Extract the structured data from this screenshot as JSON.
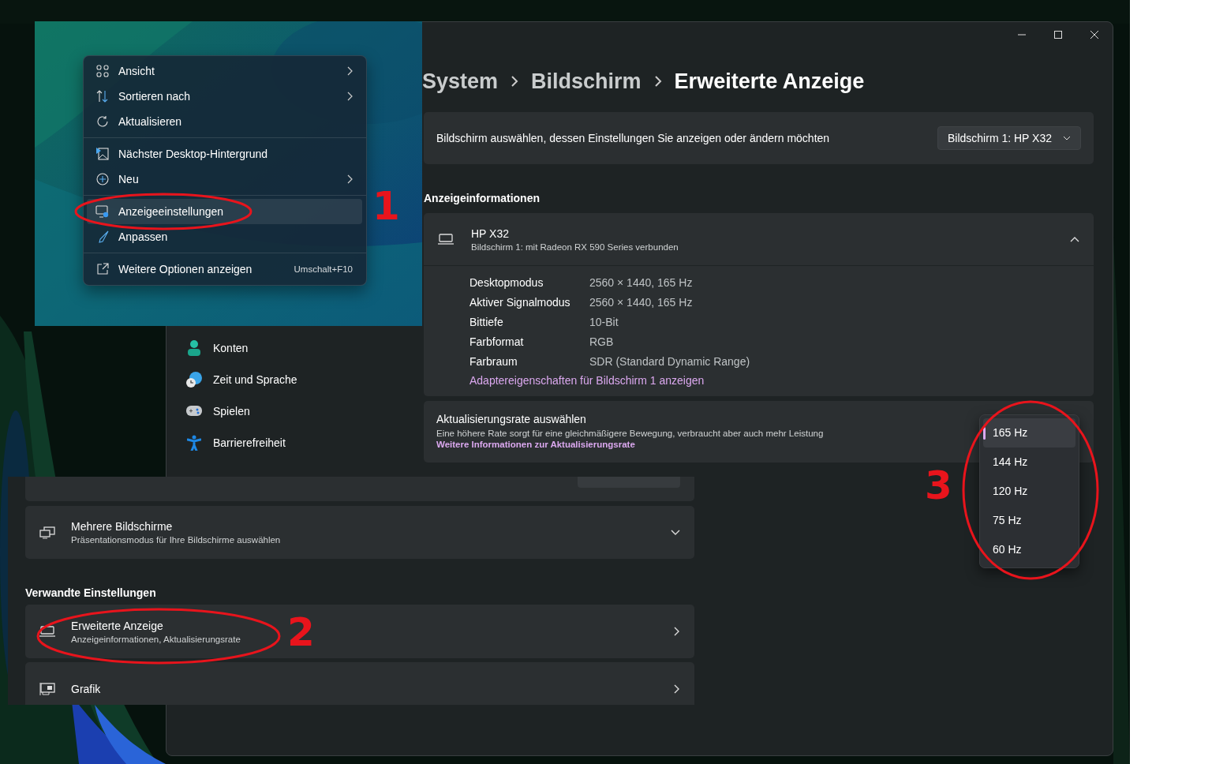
{
  "context_menu": {
    "annotation": "1",
    "groups": [
      {
        "items": [
          {
            "label": "Ansicht",
            "submenu": true,
            "selected": false
          },
          {
            "label": "Sortieren nach",
            "submenu": true,
            "selected": false
          },
          {
            "label": "Aktualisieren",
            "submenu": false,
            "selected": false
          }
        ]
      },
      {
        "items": [
          {
            "label": "Nächster Desktop-Hintergrund",
            "submenu": false,
            "selected": false
          },
          {
            "label": "Neu",
            "submenu": true,
            "selected": false
          }
        ]
      },
      {
        "items": [
          {
            "label": "Anzeigeeinstellungen",
            "submenu": false,
            "selected": true
          },
          {
            "label": "Anpassen",
            "submenu": false,
            "selected": false
          }
        ]
      },
      {
        "items": [
          {
            "label": "Weitere Optionen anzeigen",
            "shortcut": "Umschalt+F10",
            "submenu": false,
            "selected": false
          }
        ]
      }
    ]
  },
  "settings_window": {
    "breadcrumb": [
      "System",
      "Bildschirm",
      "Erweiterte Anzeige"
    ],
    "nav_items": [
      {
        "label": "Konten"
      },
      {
        "label": "Zeit und Sprache"
      },
      {
        "label": "Spielen"
      },
      {
        "label": "Barrierefreiheit"
      }
    ],
    "display_select": {
      "label": "Bildschirm auswählen, dessen Einstellungen Sie anzeigen oder ändern möchten",
      "value": "Bildschirm 1: HP X32"
    },
    "info_heading": "Anzeigeinformationen",
    "monitor": {
      "name": "HP X32",
      "subtitle": "Bildschirm 1: mit Radeon RX 590 Series verbunden",
      "expanded": true
    },
    "details": [
      {
        "label": "Desktopmodus",
        "value": "2560 × 1440, 165 Hz"
      },
      {
        "label": "Aktiver Signalmodus",
        "value": "2560 × 1440, 165 Hz"
      },
      {
        "label": "Bittiefe",
        "value": "10-Bit"
      },
      {
        "label": "Farbformat",
        "value": "RGB"
      },
      {
        "label": "Farbraum",
        "value": "SDR (Standard Dynamic Range)"
      }
    ],
    "adapter_link": "Adaptereigenschaften für Bildschirm 1 anzeigen",
    "refresh": {
      "title": "Aktualisierungsrate auswählen",
      "description": "Eine höhere Rate sorgt für eine gleichmäßigere Bewegung, verbraucht aber auch mehr Leistung",
      "link": "Weitere Informationen zur Aktualisierungsrate",
      "annotation": "3",
      "options": [
        {
          "label": "165 Hz",
          "selected": true
        },
        {
          "label": "144 Hz",
          "selected": false
        },
        {
          "label": "120 Hz",
          "selected": false
        },
        {
          "label": "75 Hz",
          "selected": false
        },
        {
          "label": "60 Hz",
          "selected": false
        }
      ]
    }
  },
  "lower_panel": {
    "multi": {
      "title": "Mehrere Bildschirme",
      "subtitle": "Präsentationsmodus für Ihre Bildschirme auswählen",
      "expanded": false
    },
    "related_heading": "Verwandte Einstellungen",
    "related": [
      {
        "title": "Erweiterte Anzeige",
        "subtitle": "Anzeigeinformationen, Aktualisierungsrate",
        "annotation": "2"
      },
      {
        "title": "Grafik"
      }
    ]
  }
}
